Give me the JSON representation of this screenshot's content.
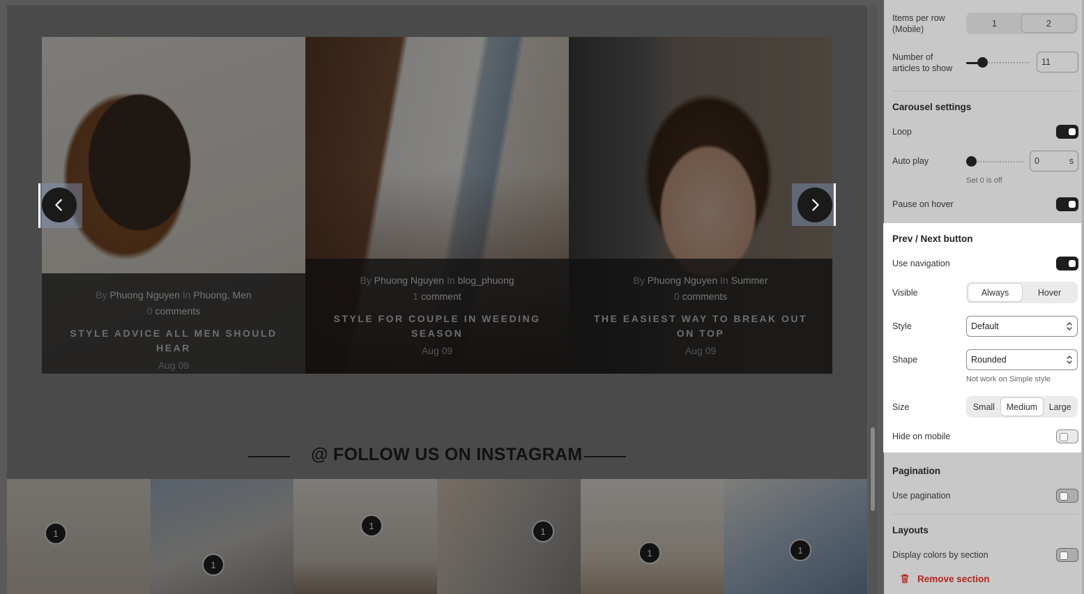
{
  "carousel": {
    "cards": [
      {
        "by": "By",
        "author": "Phuong Nguyen",
        "in": "In",
        "categories": "Phuong, Men",
        "comment_count": "0",
        "comment_word": "comments",
        "title": "STYLE ADVICE ALL MEN SHOULD HEAR",
        "date": "Aug 09"
      },
      {
        "by": "By",
        "author": "Phuong Nguyen",
        "in": "In",
        "categories": "blog_phuong",
        "comment_count": "1",
        "comment_word": "comment",
        "title": "STYLE FOR COUPLE IN WEEDING SEASON",
        "date": "Aug 09"
      },
      {
        "by": "By",
        "author": "Phuong Nguyen",
        "in": "In",
        "categories": "Summer",
        "comment_count": "0",
        "comment_word": "comments",
        "title": "THE EASIEST WAY TO BREAK OUT ON TOP",
        "date": "Aug 09"
      }
    ]
  },
  "instagram": {
    "heading": "@ FOLLOW US ON INSTAGRAM",
    "badges": [
      "1",
      "1",
      "1",
      "1",
      "1",
      "1"
    ]
  },
  "panel": {
    "items_per_row_mobile": {
      "label": "Items per row (Mobile)",
      "options": [
        "1",
        "2"
      ],
      "selected": "2"
    },
    "articles_to_show": {
      "label": "Number of articles to show",
      "value": "11"
    },
    "carousel_settings": {
      "title": "Carousel settings",
      "loop_label": "Loop",
      "loop_on": true,
      "autoplay_label": "Auto play",
      "autoplay_value": "0",
      "autoplay_unit": "s",
      "autoplay_hint": "Set 0 is off",
      "pause_label": "Pause on hover",
      "pause_on": true
    },
    "prev_next": {
      "title": "Prev / Next button",
      "use_nav_label": "Use navigation",
      "use_nav_on": true,
      "visible_label": "Visible",
      "visible_options": [
        "Always",
        "Hover"
      ],
      "visible_selected": "Always",
      "style_label": "Style",
      "style_value": "Default",
      "shape_label": "Shape",
      "shape_value": "Rounded",
      "shape_hint": "Not work on Simple style",
      "size_label": "Size",
      "size_options": [
        "Small",
        "Medium",
        "Large"
      ],
      "size_selected": "Medium",
      "hide_mobile_label": "Hide on mobile",
      "hide_mobile_on": false
    },
    "pagination": {
      "title": "Pagination",
      "use_label": "Use pagination",
      "use_on": false
    },
    "layouts": {
      "title": "Layouts",
      "colors_label": "Display colors by section",
      "colors_on": false
    },
    "remove_label": "Remove section"
  },
  "colors": {
    "remove_red": "#b3261e",
    "toggle_on": "#1e1e1e"
  }
}
